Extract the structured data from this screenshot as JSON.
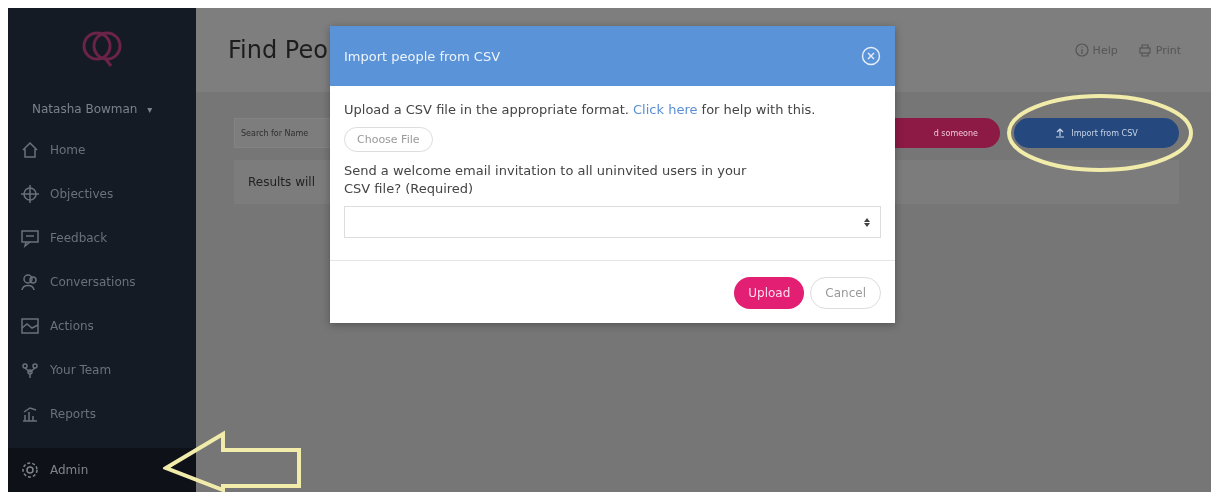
{
  "sidebar": {
    "user": {
      "name": "Natasha Bowman",
      "caret": "▾"
    },
    "items": [
      {
        "label": "Home",
        "selected": false
      },
      {
        "label": "Objectives",
        "selected": false
      },
      {
        "label": "Feedback",
        "selected": false
      },
      {
        "label": "Conversations",
        "selected": false
      },
      {
        "label": "Actions",
        "selected": false
      },
      {
        "label": "Your Team",
        "selected": false
      },
      {
        "label": "Reports",
        "selected": false
      },
      {
        "label": "Admin",
        "selected": true
      }
    ]
  },
  "header": {
    "title": "Find Peo",
    "links": [
      "Help",
      "Print"
    ]
  },
  "toolbar": {
    "search": {
      "placeholder": "Search for Name"
    },
    "add_button": "d someone",
    "import_button": "Import from CSV"
  },
  "results": {
    "text": "Results will"
  },
  "modal": {
    "title": "Import people from CSV",
    "intro": {
      "before": "Upload a CSV file in the appropriate format. ",
      "link": "Click here",
      "after": " for help with this."
    },
    "file_button": "Choose File",
    "question": "Send a welcome email invitation to all uninvited users in your CSV file? (Required)",
    "buttons": [
      {
        "label": "Upload",
        "kind": "primary"
      },
      {
        "label": "Cancel",
        "kind": "secondary"
      }
    ]
  }
}
